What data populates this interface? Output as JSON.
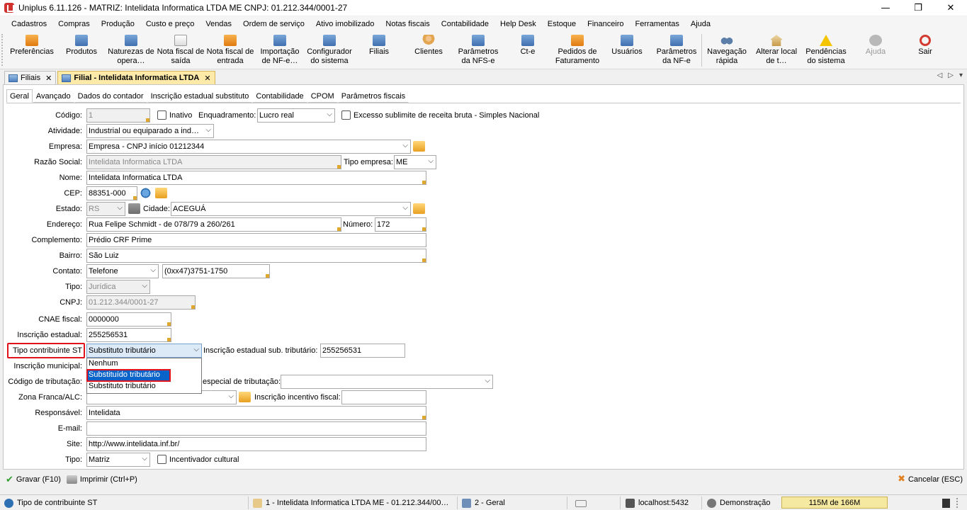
{
  "window": {
    "title": "Uniplus 6.11.126 - MATRIZ: Intelidata Informatica LTDA ME CNPJ: 01.212.344/0001-27",
    "minimize": "—",
    "maximize": "❐",
    "close": "✕"
  },
  "menu": [
    "Cadastros",
    "Compras",
    "Produção",
    "Custo e preço",
    "Vendas",
    "Ordem de serviço",
    "Ativo imobilizado",
    "Notas fiscais",
    "Contabilidade",
    "Help Desk",
    "Estoque",
    "Financeiro",
    "Ferramentas",
    "Ajuda"
  ],
  "toolbar": [
    {
      "label": "Preferências",
      "icon": "preferences-icon"
    },
    {
      "label": "Produtos",
      "icon": "products-icon"
    },
    {
      "label": "Naturezas de opera…",
      "icon": "operations-icon"
    },
    {
      "label": "Nota fiscal de saída",
      "icon": "invoice-out-icon"
    },
    {
      "label": "Nota fiscal de entrada",
      "icon": "invoice-in-icon"
    },
    {
      "label": "Importação de NF-e…",
      "icon": "import-icon"
    },
    {
      "label": "Configurador do sistema",
      "icon": "config-icon"
    },
    {
      "label": "Filiais",
      "icon": "branches-icon"
    },
    {
      "label": "Clientes",
      "icon": "clients-icon"
    },
    {
      "label": "Parâmetros da NFS-e",
      "icon": "nfse-icon"
    },
    {
      "label": "Ct-e",
      "icon": "cte-icon"
    },
    {
      "label": "Pedidos de Faturamento",
      "icon": "orders-icon"
    },
    {
      "label": "Usuários",
      "icon": "users-icon"
    },
    {
      "label": "Parâmetros da NF-e",
      "icon": "nfe-icon"
    },
    {
      "label": "Navegação rápida",
      "icon": "binoculars-icon"
    },
    {
      "label": "Alterar local de t…",
      "icon": "home-icon"
    },
    {
      "label": "Pendências do sistema",
      "icon": "warning-icon"
    },
    {
      "label": "Ajuda",
      "icon": "help-icon"
    },
    {
      "label": "Sair",
      "icon": "power-icon"
    }
  ],
  "tabs": [
    {
      "label": "Filiais",
      "close": "✕"
    },
    {
      "label": "Filial - Intelidata Informatica LTDA",
      "close": "✕"
    }
  ],
  "tab_nav": {
    "left": "◁",
    "right": "▷",
    "menu": "▾"
  },
  "subtabs": [
    "Geral",
    "Avançado",
    "Dados do contador",
    "Inscrição estadual substituto",
    "Contabilidade",
    "CPOM",
    "Parâmetros fiscais"
  ],
  "form": {
    "codigo": {
      "label": "Código:",
      "value": "1"
    },
    "inativo": "Inativo",
    "enquadramento": {
      "label": "Enquadramento:",
      "value": "Lucro real"
    },
    "excesso": "Excesso sublimite de receita bruta - Simples Nacional",
    "atividade": {
      "label": "Atividade:",
      "value": "Industrial ou equiparado a ind…"
    },
    "empresa": {
      "label": "Empresa:",
      "value": "Empresa - CNPJ início 01212344"
    },
    "razao_social": {
      "label": "Razão Social:",
      "value": "Intelidata Informatica LTDA"
    },
    "tipo_empresa": {
      "label": "Tipo empresa:",
      "value": "ME"
    },
    "nome": {
      "label": "Nome:",
      "value": "Intelidata Informatica LTDA"
    },
    "cep": {
      "label": "CEP:",
      "value": "88351-000"
    },
    "estado": {
      "label": "Estado:",
      "value": "RS"
    },
    "cidade": {
      "label": "Cidade:",
      "value": "ACEGUÁ"
    },
    "endereco": {
      "label": "Endereço:",
      "value": "Rua Felipe Schmidt - de 078/79 a 260/261"
    },
    "numero": {
      "label": "Número:",
      "value": "172"
    },
    "complemento": {
      "label": "Complemento:",
      "value": "Prédio CRF Prime"
    },
    "bairro": {
      "label": "Bairro:",
      "value": "São Luiz"
    },
    "contato": {
      "label": "Contato:",
      "type": "Telefone",
      "value": "(0xx47)3751-1750"
    },
    "tipo_pessoa": {
      "label": "Tipo:",
      "value": "Jurídica"
    },
    "cnpj": {
      "label": "CNPJ:",
      "value": "01.212.344/0001-27"
    },
    "cnae": {
      "label": "CNAE fiscal:",
      "value": "0000000"
    },
    "ie": {
      "label": "Inscrição estadual:",
      "value": "255256531"
    },
    "tipo_contribuinte": {
      "label": "Tipo contribuinte ST",
      "value": "Substituto tributário"
    },
    "ie_sub": {
      "label": "Inscrição estadual sub. tributário:",
      "value": "255256531"
    },
    "im": {
      "label": "Inscrição municipal:"
    },
    "cod_trib": {
      "label": "Código de tributação:",
      "regime_label": "especial de tributação:"
    },
    "zona_franca": {
      "label": "Zona Franca/ALC:",
      "incentivo_label": "Inscrição incentivo fiscal:"
    },
    "responsavel": {
      "label": "Responsável:",
      "value": "Intelidata"
    },
    "email": {
      "label": "E-mail:",
      "value": ""
    },
    "site": {
      "label": "Site:",
      "value": "http://www.intelidata.inf.br/"
    },
    "tipo": {
      "label": "Tipo:",
      "value": "Matriz"
    },
    "incentivador": "Incentivador cultural"
  },
  "dropdown_options": [
    "Nenhum",
    "Substituído tributário",
    "Substituto tributário"
  ],
  "dropdown_selected_index": 1,
  "bottom": {
    "save": "Gravar (F10)",
    "print": "Imprimir (Ctrl+P)",
    "cancel": "Cancelar (ESC)"
  },
  "status": {
    "help": "Tipo de contribuinte ST",
    "company": "1 - Intelidata Informatica LTDA ME - 01.212.344/00…",
    "module": "2 - Geral",
    "server": "localhost:5432",
    "user": "Demonstração",
    "memory": "115M de 166M"
  },
  "glyphs": {
    "arrow": "⌵",
    "check": "✔",
    "cancel": "✖"
  }
}
